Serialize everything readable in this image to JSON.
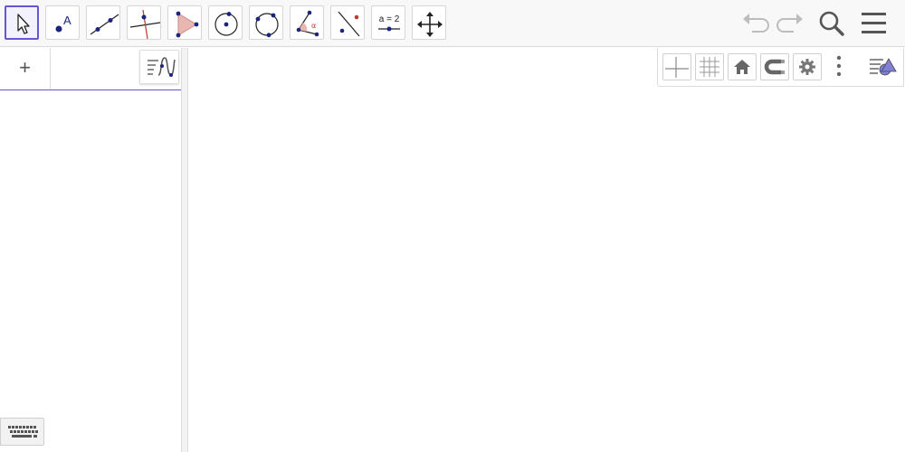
{
  "toolbar": {
    "tools": [
      {
        "name": "move-tool",
        "selected": true
      },
      {
        "name": "point-tool",
        "icon_text": "A"
      },
      {
        "name": "line-tool"
      },
      {
        "name": "perpendicular-line-tool"
      },
      {
        "name": "polygon-tool"
      },
      {
        "name": "circle-center-point-tool"
      },
      {
        "name": "circle-three-points-tool"
      },
      {
        "name": "angle-tool",
        "icon_text": "α"
      },
      {
        "name": "reflect-about-line-tool"
      },
      {
        "name": "slider-tool",
        "icon_text": "a = 2"
      },
      {
        "name": "move-graphics-view-tool"
      }
    ],
    "right": [
      "undo-icon",
      "redo-icon",
      "search-icon",
      "menu-icon"
    ]
  },
  "algebra": {
    "add_label": "+",
    "input_value": "",
    "style_icon": "algebra-style-icon"
  },
  "graphics_bar": {
    "buttons": [
      "axes-toggle",
      "grid-toggle",
      "standard-view-home",
      "point-capturing",
      "graphics-settings",
      "more-options",
      "graphics-style-bar-toggle"
    ]
  },
  "colors": {
    "accent": "#6557d2",
    "point": "#1a237e",
    "line": "#000000",
    "red_line": "#c0392b",
    "polygon_fill": "#e8b7b2"
  }
}
